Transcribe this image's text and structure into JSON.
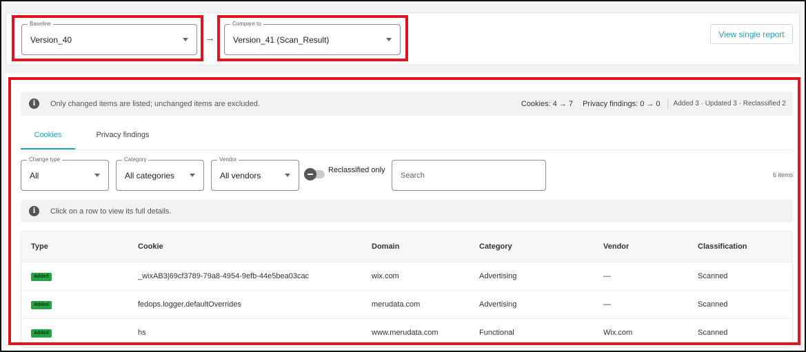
{
  "compare": {
    "baseline_label": "Baseline",
    "baseline_value": "Version_40",
    "compare_label": "Compare to",
    "compare_value": "Version_41 (Scan_Result)",
    "view_single_report": "View single report"
  },
  "notice": {
    "text": "Only changed items are listed; unchanged items are excluded.",
    "cookies_stat": "Cookies: 4 → 7",
    "privacy_stat": "Privacy findings: 0 → 0",
    "summary": "Added 3 · Updated 3 · Reclassified 2"
  },
  "tabs": [
    {
      "label": "Cookies",
      "active": true
    },
    {
      "label": "Privacy findings",
      "active": false
    }
  ],
  "filters": {
    "change_type_label": "Change type",
    "change_type_value": "All",
    "category_label": "Category",
    "category_value": "All categories",
    "vendor_label": "Vendor",
    "vendor_value": "All vendors",
    "reclassified_label": "Reclassified only",
    "search_placeholder": "Search",
    "item_count": "6 items"
  },
  "hint": "Click on a row to view its full details.",
  "table": {
    "columns": [
      "Type",
      "Cookie",
      "Domain",
      "Category",
      "Vendor",
      "Classification"
    ],
    "rows": [
      {
        "type": "Added",
        "cookie": "_wixAB3|69cf3789-79a8-4954-9efb-44e5bea03cac",
        "domain": "wix.com",
        "category": "Advertising",
        "vendor": "—",
        "classification": "Scanned"
      },
      {
        "type": "Added",
        "cookie": "fedops.logger.defaultOverrides",
        "domain": "merudata.com",
        "category": "Advertising",
        "vendor": "—",
        "classification": "Scanned"
      },
      {
        "type": "Added",
        "cookie": "hs",
        "domain": "www.merudata.com",
        "category": "Functional",
        "vendor": "Wix.com",
        "classification": "Scanned"
      }
    ]
  },
  "colors": {
    "accent": "#1ba5c4",
    "highlight_border": "#e0151f",
    "added_badge": "#25a244"
  }
}
